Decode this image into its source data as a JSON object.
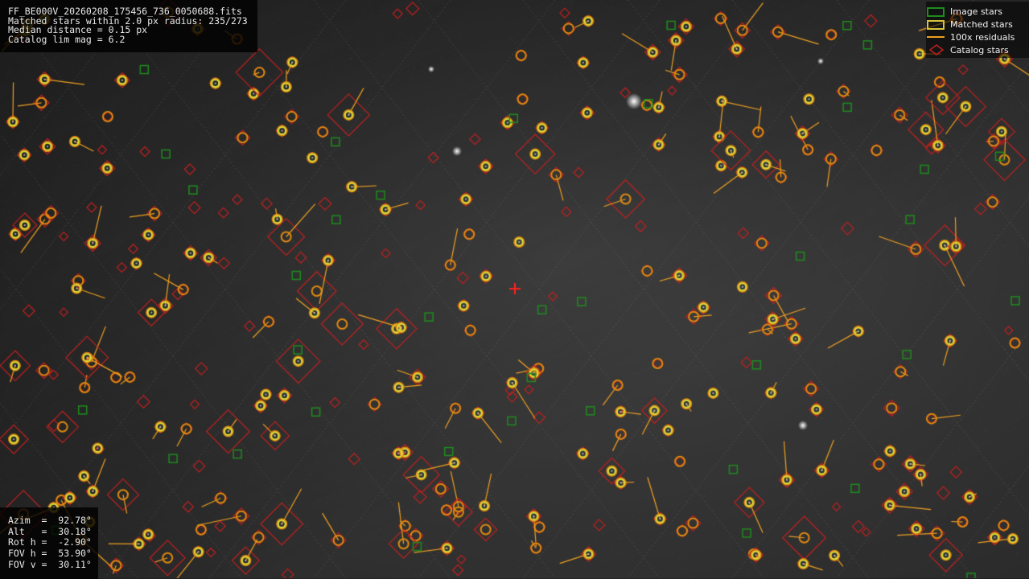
{
  "info": {
    "filename": "FF_BE000V_20260208_175456_736_0050688.fits",
    "matched": "Matched stars within 2.0 px radius: 235/273",
    "median": "Median distance = 0.15 px",
    "catalog": "Catalog lim mag = 6.2"
  },
  "pointing": {
    "azim": "Azim  =  92.78°",
    "alt": "Alt   =  30.18°",
    "rot": "Rot h =  -2.90°",
    "fov_h": "FOV h =  53.90°",
    "fov_v": "FOV v =  30.11°"
  },
  "legend": {
    "image_stars": "Image stars",
    "matched_stars": "Matched stars",
    "residuals": "100x residuals",
    "catalog_stars": "Catalog stars"
  },
  "colors": {
    "image_star": "#1e8c1e",
    "matched_inner": "#d9e040",
    "matched_outer": "#e08a10",
    "residual": "#f0a020",
    "catalog": "#c02020",
    "center_marker": "#ff2020"
  },
  "icons": {
    "center": "red-cross-center-marker"
  }
}
